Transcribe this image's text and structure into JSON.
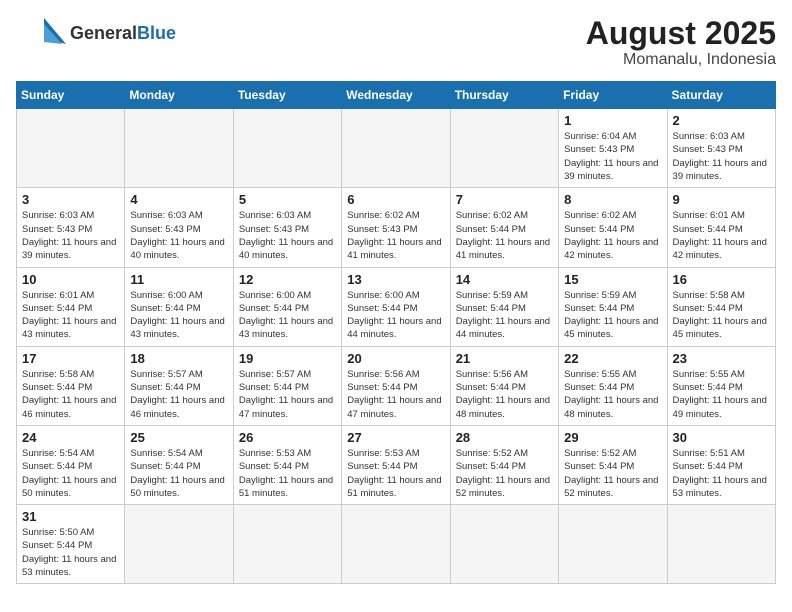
{
  "header": {
    "logo_general": "General",
    "logo_blue": "Blue",
    "title": "August 2025",
    "subtitle": "Momanalu, Indonesia"
  },
  "calendar": {
    "days_of_week": [
      "Sunday",
      "Monday",
      "Tuesday",
      "Wednesday",
      "Thursday",
      "Friday",
      "Saturday"
    ],
    "weeks": [
      [
        {
          "day": "",
          "info": ""
        },
        {
          "day": "",
          "info": ""
        },
        {
          "day": "",
          "info": ""
        },
        {
          "day": "",
          "info": ""
        },
        {
          "day": "",
          "info": ""
        },
        {
          "day": "1",
          "info": "Sunrise: 6:04 AM\nSunset: 5:43 PM\nDaylight: 11 hours\nand 39 minutes."
        },
        {
          "day": "2",
          "info": "Sunrise: 6:03 AM\nSunset: 5:43 PM\nDaylight: 11 hours\nand 39 minutes."
        }
      ],
      [
        {
          "day": "3",
          "info": "Sunrise: 6:03 AM\nSunset: 5:43 PM\nDaylight: 11 hours\nand 39 minutes."
        },
        {
          "day": "4",
          "info": "Sunrise: 6:03 AM\nSunset: 5:43 PM\nDaylight: 11 hours\nand 40 minutes."
        },
        {
          "day": "5",
          "info": "Sunrise: 6:03 AM\nSunset: 5:43 PM\nDaylight: 11 hours\nand 40 minutes."
        },
        {
          "day": "6",
          "info": "Sunrise: 6:02 AM\nSunset: 5:43 PM\nDaylight: 11 hours\nand 41 minutes."
        },
        {
          "day": "7",
          "info": "Sunrise: 6:02 AM\nSunset: 5:44 PM\nDaylight: 11 hours\nand 41 minutes."
        },
        {
          "day": "8",
          "info": "Sunrise: 6:02 AM\nSunset: 5:44 PM\nDaylight: 11 hours\nand 42 minutes."
        },
        {
          "day": "9",
          "info": "Sunrise: 6:01 AM\nSunset: 5:44 PM\nDaylight: 11 hours\nand 42 minutes."
        }
      ],
      [
        {
          "day": "10",
          "info": "Sunrise: 6:01 AM\nSunset: 5:44 PM\nDaylight: 11 hours\nand 43 minutes."
        },
        {
          "day": "11",
          "info": "Sunrise: 6:00 AM\nSunset: 5:44 PM\nDaylight: 11 hours\nand 43 minutes."
        },
        {
          "day": "12",
          "info": "Sunrise: 6:00 AM\nSunset: 5:44 PM\nDaylight: 11 hours\nand 43 minutes."
        },
        {
          "day": "13",
          "info": "Sunrise: 6:00 AM\nSunset: 5:44 PM\nDaylight: 11 hours\nand 44 minutes."
        },
        {
          "day": "14",
          "info": "Sunrise: 5:59 AM\nSunset: 5:44 PM\nDaylight: 11 hours\nand 44 minutes."
        },
        {
          "day": "15",
          "info": "Sunrise: 5:59 AM\nSunset: 5:44 PM\nDaylight: 11 hours\nand 45 minutes."
        },
        {
          "day": "16",
          "info": "Sunrise: 5:58 AM\nSunset: 5:44 PM\nDaylight: 11 hours\nand 45 minutes."
        }
      ],
      [
        {
          "day": "17",
          "info": "Sunrise: 5:58 AM\nSunset: 5:44 PM\nDaylight: 11 hours\nand 46 minutes."
        },
        {
          "day": "18",
          "info": "Sunrise: 5:57 AM\nSunset: 5:44 PM\nDaylight: 11 hours\nand 46 minutes."
        },
        {
          "day": "19",
          "info": "Sunrise: 5:57 AM\nSunset: 5:44 PM\nDaylight: 11 hours\nand 47 minutes."
        },
        {
          "day": "20",
          "info": "Sunrise: 5:56 AM\nSunset: 5:44 PM\nDaylight: 11 hours\nand 47 minutes."
        },
        {
          "day": "21",
          "info": "Sunrise: 5:56 AM\nSunset: 5:44 PM\nDaylight: 11 hours\nand 48 minutes."
        },
        {
          "day": "22",
          "info": "Sunrise: 5:55 AM\nSunset: 5:44 PM\nDaylight: 11 hours\nand 48 minutes."
        },
        {
          "day": "23",
          "info": "Sunrise: 5:55 AM\nSunset: 5:44 PM\nDaylight: 11 hours\nand 49 minutes."
        }
      ],
      [
        {
          "day": "24",
          "info": "Sunrise: 5:54 AM\nSunset: 5:44 PM\nDaylight: 11 hours\nand 50 minutes."
        },
        {
          "day": "25",
          "info": "Sunrise: 5:54 AM\nSunset: 5:44 PM\nDaylight: 11 hours\nand 50 minutes."
        },
        {
          "day": "26",
          "info": "Sunrise: 5:53 AM\nSunset: 5:44 PM\nDaylight: 11 hours\nand 51 minutes."
        },
        {
          "day": "27",
          "info": "Sunrise: 5:53 AM\nSunset: 5:44 PM\nDaylight: 11 hours\nand 51 minutes."
        },
        {
          "day": "28",
          "info": "Sunrise: 5:52 AM\nSunset: 5:44 PM\nDaylight: 11 hours\nand 52 minutes."
        },
        {
          "day": "29",
          "info": "Sunrise: 5:52 AM\nSunset: 5:44 PM\nDaylight: 11 hours\nand 52 minutes."
        },
        {
          "day": "30",
          "info": "Sunrise: 5:51 AM\nSunset: 5:44 PM\nDaylight: 11 hours\nand 53 minutes."
        }
      ],
      [
        {
          "day": "31",
          "info": "Sunrise: 5:50 AM\nSunset: 5:44 PM\nDaylight: 11 hours\nand 53 minutes."
        },
        {
          "day": "",
          "info": ""
        },
        {
          "day": "",
          "info": ""
        },
        {
          "day": "",
          "info": ""
        },
        {
          "day": "",
          "info": ""
        },
        {
          "day": "",
          "info": ""
        },
        {
          "day": "",
          "info": ""
        }
      ]
    ]
  }
}
